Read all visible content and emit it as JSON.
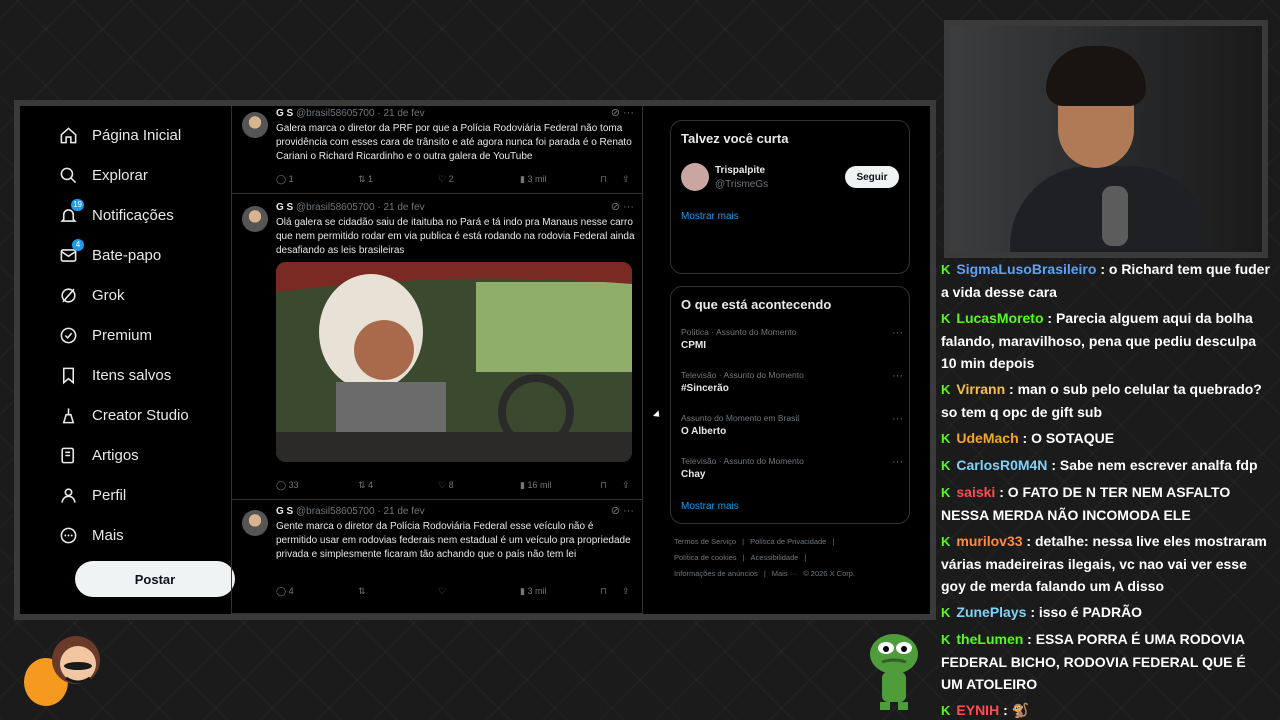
{
  "sidebar": {
    "items": [
      {
        "label": "Página Inicial",
        "icon": "home-icon"
      },
      {
        "label": "Explorar",
        "icon": "search-icon"
      },
      {
        "label": "Notificações",
        "icon": "bell-icon",
        "badge": "19"
      },
      {
        "label": "Bate-papo",
        "icon": "mail-icon",
        "badge": "4"
      },
      {
        "label": "Grok",
        "icon": "grok-icon"
      },
      {
        "label": "Premium",
        "icon": "premium-icon"
      },
      {
        "label": "Itens salvos",
        "icon": "bookmark-icon"
      },
      {
        "label": "Creator Studio",
        "icon": "creator-icon"
      },
      {
        "label": "Artigos",
        "icon": "article-icon"
      },
      {
        "label": "Perfil",
        "icon": "person-icon"
      },
      {
        "label": "Mais",
        "icon": "more-circle-icon"
      }
    ],
    "post_label": "Postar"
  },
  "tweets": [
    {
      "name": "G S",
      "handle": "@brasil58605700",
      "date": "· 21 de fev",
      "text": "Galera marca o diretor da PRF por que a Polícia Rodoviária Federal não toma providência com esses cara de trânsito e até agora nunca foi parada é o Renato Cariani o Richard Ricardinho e o outra galera de YouTube",
      "replies": "1",
      "reposts": "1",
      "likes": "2",
      "views": "3 mil"
    },
    {
      "name": "G S",
      "handle": "@brasil58605700",
      "date": "· 21 de fev",
      "text": "Olá galera se cidadão saiu de itaituba no Pará e tá indo pra Manaus nesse carro que nem permitido rodar em via publica é está rodando na rodovia Federal ainda desafiando as leis brasileiras",
      "replies": "33",
      "reposts": "4",
      "likes": "8",
      "views": "16 mil"
    },
    {
      "name": "G S",
      "handle": "@brasil58605700",
      "date": "· 21 de fev",
      "text": "Gente marca o diretor da Polícia Rodoviária Federal esse veículo não é permitido usar em rodovias federais nem estadual é um veículo pra propriedade privada e simplesmente ficaram tão achando que o país não tem lei",
      "replies": "4",
      "reposts": "",
      "likes": "",
      "views": "3 mil"
    }
  ],
  "suggest": {
    "title": "Talvez você curta",
    "user_name": "Trispalpite",
    "user_handle": "@TrismeGs",
    "follow_label": "Seguir",
    "more_label": "Mostrar mais"
  },
  "trends": {
    "title": "O que está acontecendo",
    "items": [
      {
        "category": "Política · Assunto do Momento",
        "name": "CPMI"
      },
      {
        "category": "Televisão · Assunto do Momento",
        "name": "#Sincerão"
      },
      {
        "category": "Assunto do Momento em Brasil",
        "name": "O Alberto"
      },
      {
        "category": "Televisão · Assunto do Momento",
        "name": "Chay"
      }
    ],
    "more_label": "Mostrar mais"
  },
  "footer": {
    "links": [
      "Termos de Serviço",
      "|",
      "Política de Privacidade",
      "|",
      "Política de cookies",
      "|",
      "Acessibilidade",
      "|",
      "Informações de anúncios",
      "|",
      "Mais ···",
      "© 2026 X Corp."
    ]
  },
  "chat": [
    {
      "user": "SigmaLusoBrasileiro",
      "color": "#5ea3f0",
      "text": ": o Richard tem que fuder a vida desse cara"
    },
    {
      "user": "LucasMoreto",
      "color": "#53fc18",
      "text": ": Parecia alguem aqui da bolha falando, maravilhoso, pena que pediu desculpa 10 min depois"
    },
    {
      "user": "Virrann",
      "color": "#f5c04a",
      "text": ": man o sub pelo celular ta quebrado? so tem q opc de gift sub"
    },
    {
      "user": "UdeMach",
      "color": "#f5a623",
      "text": ": O SOTAQUE"
    },
    {
      "user": "CarlosR0M4N",
      "color": "#7fd3f7",
      "text": ": Sabe nem escrever analfa fdp"
    },
    {
      "user": "saiski",
      "color": "#ff4d4d",
      "text": ": O FATO DE N TER NEM ASFALTO NESSA MERDA NÃO INCOMODA ELE"
    },
    {
      "user": "murilov33",
      "color": "#ff8c42",
      "text": ": detalhe: nessa live eles mostraram várias madeireiras ilegais, vc nao vai ver esse goy de merda falando um A disso"
    },
    {
      "user": "ZunePlays",
      "color": "#7fd3f7",
      "text": ": isso é PADRÃO"
    },
    {
      "user": "theLumen",
      "color": "#53fc18",
      "text": ": ESSA PORRA É UMA RODOVIA FEDERAL BICHO, RODOVIA FEDERAL QUE É UM ATOLEIRO"
    },
    {
      "user": "EYNIH",
      "color": "#ff4d4d",
      "text": ":"
    }
  ]
}
